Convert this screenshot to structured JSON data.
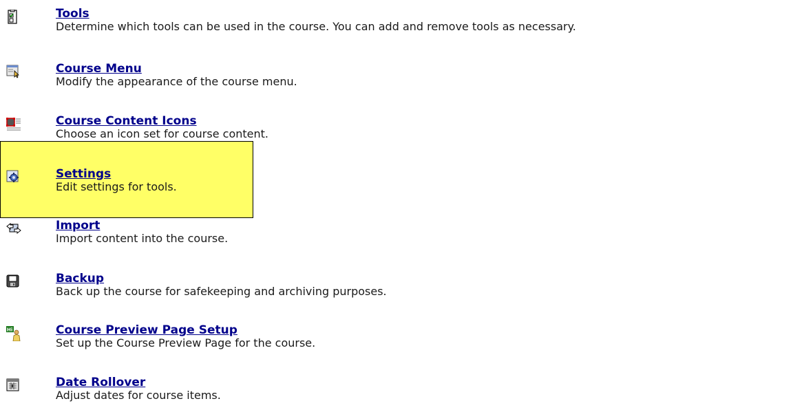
{
  "items": [
    {
      "title": "Tools",
      "description": "Determine which tools can be used in the course. You can add and remove tools as necessary.",
      "icon": "tools-checklist-icon"
    },
    {
      "title": "Course Menu",
      "description": "Modify the appearance of the course menu.",
      "icon": "course-menu-icon"
    },
    {
      "title": "Course Content Icons",
      "description": "Choose an icon set for course content.",
      "icon": "content-icons-icon"
    },
    {
      "title": "Settings",
      "description": "Edit settings for tools.",
      "icon": "settings-gear-icon"
    },
    {
      "title": "Import",
      "description": "Import content into the course.",
      "icon": "import-icon"
    },
    {
      "title": "Backup",
      "description": "Back up the course for safekeeping and archiving purposes.",
      "icon": "backup-disk-icon"
    },
    {
      "title": "Course Preview Page Setup",
      "description": "Set up the Course Preview Page for the course.",
      "icon": "preview-page-icon"
    },
    {
      "title": "Date Rollover",
      "description": "Adjust dates for course items.",
      "icon": "calendar-icon"
    }
  ],
  "colors": {
    "link": "#00008b",
    "highlight": "#ffff66"
  }
}
